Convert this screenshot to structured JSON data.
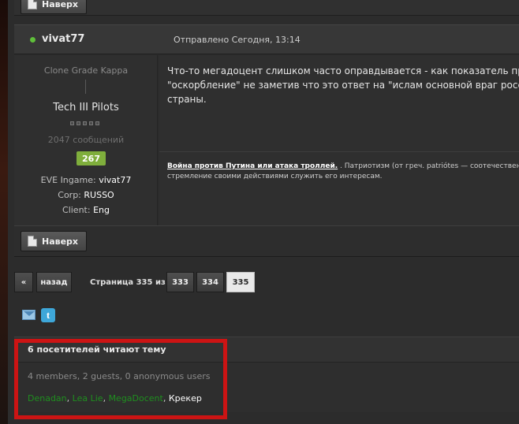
{
  "top_button": {
    "label": "Наверх",
    "icon": "document-icon"
  },
  "post": {
    "author": "vivat77",
    "online": true,
    "date": "Отправлено Сегодня, 13:14",
    "rank": "Clone Grade Kappa",
    "group": "Tech III Pilots",
    "post_count": "2047 сообщений",
    "reputation": "267",
    "eve_ingame_label": "EVE Ingame:",
    "eve_ingame_value": "vivat77",
    "corp_label": "Corp:",
    "corp_value": "RUSSO",
    "client_label": "Client:",
    "client_value": "Eng",
    "text_line1": "Что-то мегадоцент слишком часто оправдывается - как показатель профпр",
    "text_line2": "\"оскорбление\" не заметив что это ответ на \"ислам основной враг россии\" ч",
    "text_line3": "страны.",
    "signature_link": "Война против Путина или атака троллей.",
    "signature_line1": " . Патриотизм (от греч. patriótes — соотечественник,",
    "signature_line2": "стремление своими действиями служить его интересам."
  },
  "footer_button": {
    "label": "Наверх",
    "icon": "document-icon"
  },
  "pagination": {
    "first": "«",
    "back": "назад",
    "label": "Страница 335 из 335",
    "pages": [
      "333",
      "334",
      "335"
    ],
    "current": "335"
  },
  "share": {
    "icons": [
      "email-icon",
      "twitter-icon"
    ],
    "twitter_glyph": "t"
  },
  "viewers": {
    "title": "6 посетителей читают тему",
    "summary": "4 members, 2 guests, 0 anonymous users",
    "names": [
      {
        "name": "Denadan",
        "color": "#1f8f1f"
      },
      {
        "name": "Lea Lie",
        "color": "#1f8f1f"
      },
      {
        "name": "MegaDocent",
        "color": "#1f8f1f"
      },
      {
        "name": "Крекер",
        "color": "#ffffff"
      }
    ],
    "separator": ", "
  },
  "colors": {
    "online": "#5fbf3a",
    "reputation": "#7fae3c",
    "highlight": "#cc1414",
    "member_green": "#1f8f1f"
  }
}
